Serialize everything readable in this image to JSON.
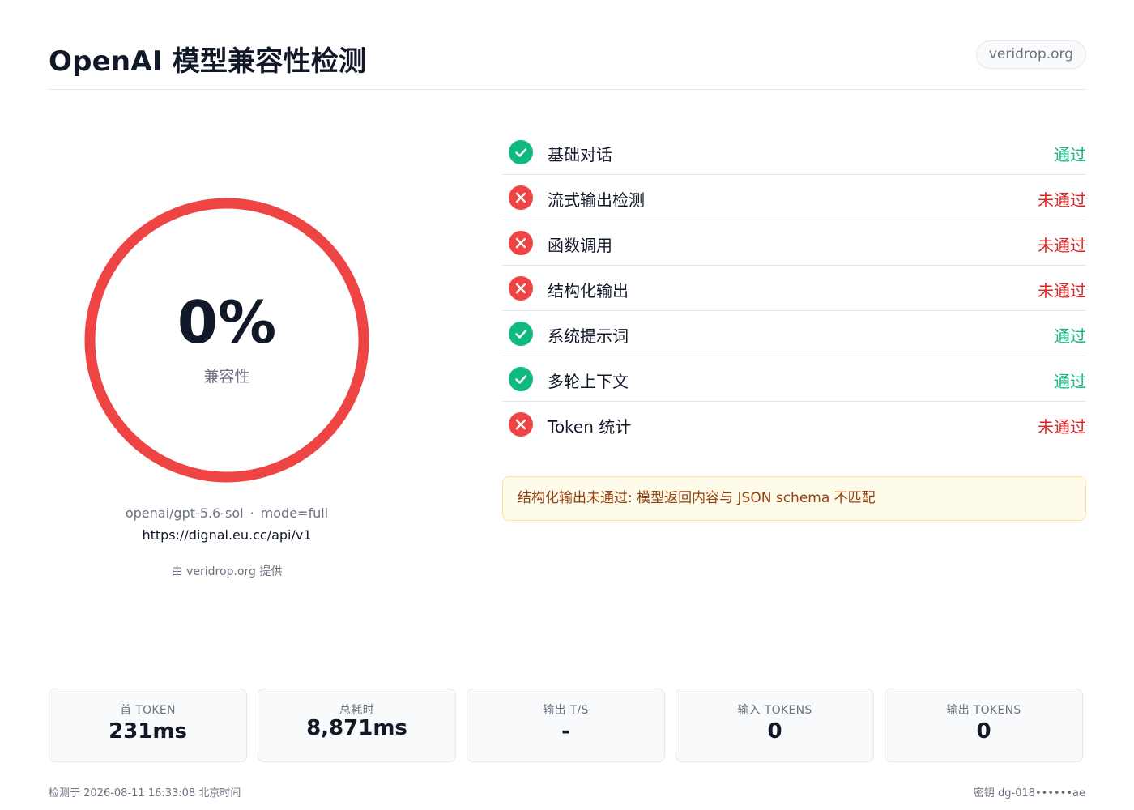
{
  "header": {
    "title": "OpenAI 模型兼容性检测",
    "domain_badge": "veridrop.org"
  },
  "score": {
    "value": "0%",
    "label": "兼容性",
    "ring_color": "#ef4444",
    "model": "openai/gpt-5.6-sol",
    "mode": "mode=full",
    "separator": "·",
    "endpoint": "https://dignal.eu.cc/api/v1",
    "powered_by": "由 veridrop.org 提供"
  },
  "checks": [
    {
      "name": "基础对话",
      "status": "通过",
      "ok": true,
      "icon": "check-icon"
    },
    {
      "name": "流式输出检测",
      "status": "未通过",
      "ok": false,
      "icon": "cross-icon"
    },
    {
      "name": "函数调用",
      "status": "未通过",
      "ok": false,
      "icon": "cross-icon"
    },
    {
      "name": "结构化输出",
      "status": "未通过",
      "ok": false,
      "icon": "cross-icon"
    },
    {
      "name": "系统提示词",
      "status": "通过",
      "ok": true,
      "icon": "check-icon"
    },
    {
      "name": "多轮上下文",
      "status": "通过",
      "ok": true,
      "icon": "check-icon"
    },
    {
      "name": "Token 统计",
      "status": "未通过",
      "ok": false,
      "icon": "cross-icon"
    }
  ],
  "warning": "结构化输出未通过: 模型返回内容与 JSON schema 不匹配",
  "stats": [
    {
      "label": "首 TOKEN",
      "value": "231ms"
    },
    {
      "label": "总耗时",
      "value": "8,871ms"
    },
    {
      "label": "输出 T/S",
      "value": "-"
    },
    {
      "label": "输入 TOKENS",
      "value": "0"
    },
    {
      "label": "输出 TOKENS",
      "value": "0"
    }
  ],
  "footer": {
    "left": "检测于 2026-08-11 16:33:08 北京时间",
    "right": "密钥 dg-018••••••ae"
  },
  "colors": {
    "pass": "#10b981",
    "fail": "#dc2626",
    "warning_bg": "#fffbeb",
    "warning_text": "#92400e"
  }
}
